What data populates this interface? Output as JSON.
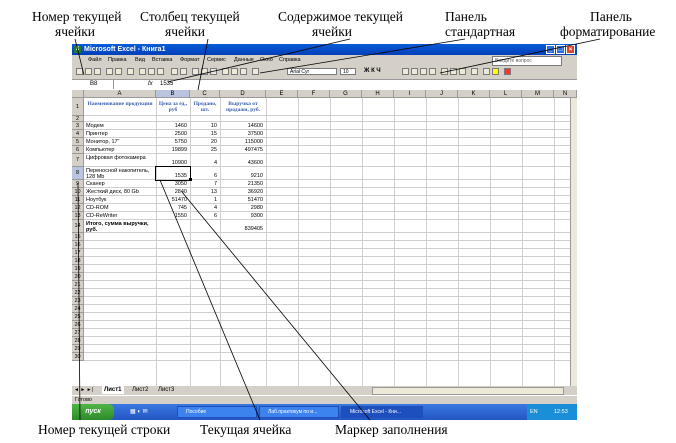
{
  "annotations": {
    "cell_number": "Номер текущей",
    "cell_number2": "ячейки",
    "column": "Столбец текущей",
    "column2": "ячейки",
    "content": "Содержимое текущей",
    "content2": "ячейки",
    "std_panel": "Панель",
    "std_panel2": "стандартная",
    "fmt_panel": "Панель",
    "fmt_panel2": "форматирование",
    "row_number": "Номер текущей  строки",
    "current_cell": "Текущая ячейка",
    "fill_marker": "Маркер заполнения"
  },
  "window": {
    "title": "Microsoft Excel - Книга1",
    "minimize": "_",
    "maximize": "□",
    "close": "×"
  },
  "menu": [
    "Файл",
    "Правка",
    "Вид",
    "Вставка",
    "Формат",
    "Сервис",
    "Данные",
    "Окно",
    "Справка"
  ],
  "help_box": "Введите вопрос",
  "toolbar": {
    "font": "Arial Cyr",
    "size": "10",
    "zoom": "Ж К Ч"
  },
  "formula_bar": {
    "name_box": "B8",
    "fx": "fx",
    "value": "1535"
  },
  "columns": [
    "A",
    "B",
    "C",
    "D",
    "E",
    "F",
    "G",
    "H",
    "I",
    "J",
    "K",
    "L",
    "M",
    "N"
  ],
  "header_cells": {
    "a": "Наименование продукции",
    "b": "Цена за ед., руб",
    "c": "Продано, шт.",
    "d": "Выручка от продажи, руб."
  },
  "rows": [
    {
      "n": "3",
      "a": "Модем",
      "b": "1460",
      "c": "10",
      "d": "14600"
    },
    {
      "n": "4",
      "a": "Принтер",
      "b": "2500",
      "c": "15",
      "d": "37500"
    },
    {
      "n": "5",
      "a": "Монитор, 17\"",
      "b": "5750",
      "c": "20",
      "d": "115000"
    },
    {
      "n": "6",
      "a": "Компьютер",
      "b": "19899",
      "c": "25",
      "d": "497475"
    },
    {
      "n": "7",
      "a": "Цифровая фотокамера",
      "b": "10900",
      "c": "4",
      "d": "43600"
    },
    {
      "n": "8",
      "a": "Переносной накопитель, 128 Mb",
      "b": "1535",
      "c": "6",
      "d": "9210"
    },
    {
      "n": "9",
      "a": "Сканер",
      "b": "3050",
      "c": "7",
      "d": "21350"
    },
    {
      "n": "10",
      "a": "Жесткий диск, 80 Gb",
      "b": "2840",
      "c": "13",
      "d": "36920"
    },
    {
      "n": "11",
      "a": "Ноутбук",
      "b": "51470",
      "c": "1",
      "d": "51470"
    },
    {
      "n": "12",
      "a": "CD-ROM",
      "b": "745",
      "c": "4",
      "d": "2980"
    },
    {
      "n": "13",
      "a": "CD-ReWriter",
      "b": "1550",
      "c": "6",
      "d": "9300"
    }
  ],
  "total": {
    "n": "14",
    "a": "Итого, сумма выручки, руб.",
    "d": "839405"
  },
  "row_numbers": [
    "1",
    "2",
    "3",
    "4",
    "5",
    "6",
    "7",
    "8",
    "9",
    "10",
    "11",
    "12",
    "13",
    "14",
    "15",
    "16",
    "17",
    "18",
    "19",
    "20",
    "21",
    "22",
    "23",
    "24",
    "25",
    "26",
    "27",
    "28",
    "29",
    "30"
  ],
  "sheets": [
    "Лист1",
    "Лист2",
    "Лист3"
  ],
  "status": "Готово",
  "taskbar": {
    "start": "пуск",
    "items": [
      "Пособие",
      "Лаб.практикум по и...",
      "Microsoft Excel - Кни..."
    ],
    "lang": "EN",
    "time": "12:53"
  }
}
